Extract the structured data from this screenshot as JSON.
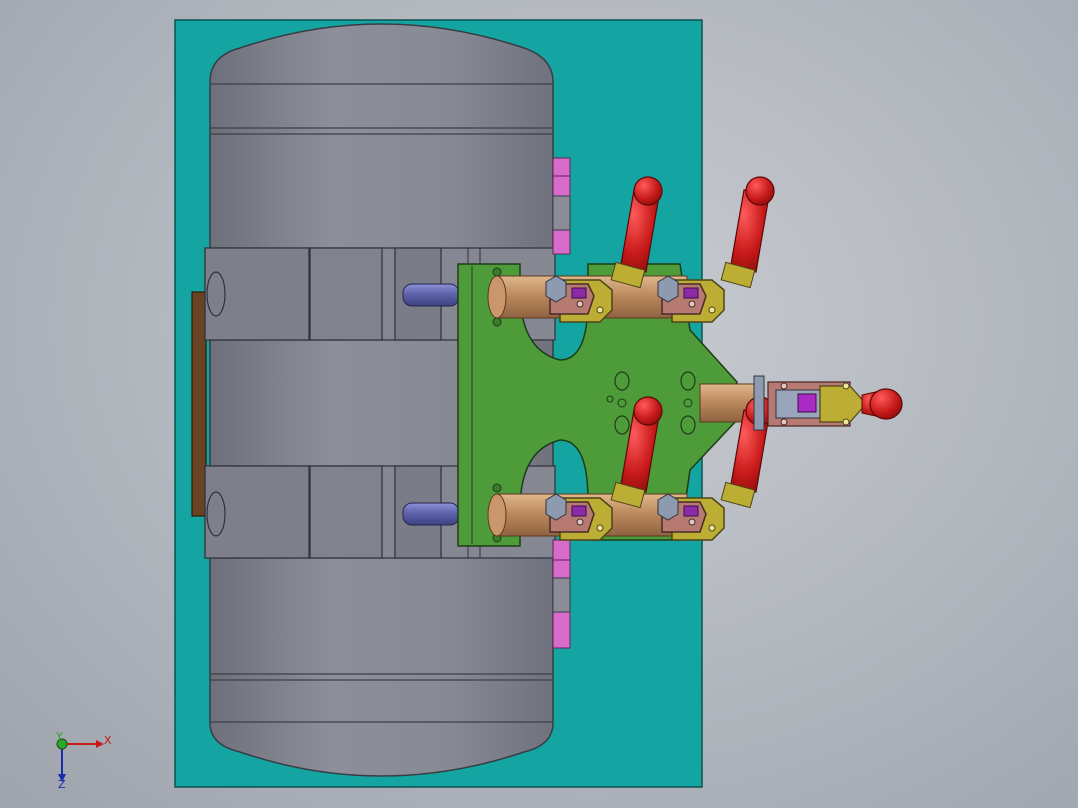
{
  "viewport": {
    "triad": {
      "x_label": "X",
      "y_label": "Y",
      "z_label": "Z"
    }
  },
  "colors": {
    "background": "#b6bac1",
    "base_plate": "#14a5a2",
    "tank": "#8a8d98",
    "fixture_plate": "#4e9b3a",
    "clamp_handle": "#c81a1a",
    "clamp_arm": "#bcae34",
    "clamp_link": "#b77a72",
    "shaft": "#c09060",
    "pin": "#5b5fa8",
    "spacer": "#d66bc8",
    "backing_block": "#6a4422"
  }
}
